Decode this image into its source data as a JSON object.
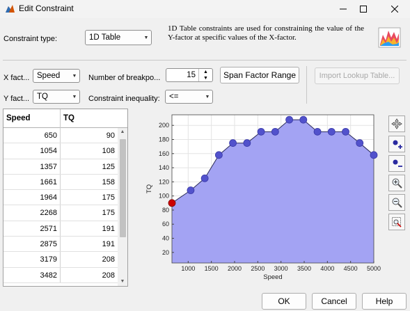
{
  "window": {
    "title": "Edit Constraint"
  },
  "constraint_type": {
    "label": "Constraint type:",
    "value": "1D Table"
  },
  "info_text": "1D Table constraints are used for constraining the value of the Y-factor at specific values of the X-factor.",
  "x_factor": {
    "label": "X fact...",
    "value": "Speed"
  },
  "y_factor": {
    "label": "Y fact...",
    "value": "TQ"
  },
  "breakpoints": {
    "label": "Number of breakpo...",
    "value": "15"
  },
  "inequality": {
    "label": "Constraint inequality:",
    "value": "<="
  },
  "buttons": {
    "span": "Span Factor Range",
    "import": "Import Lookup Table...",
    "ok": "OK",
    "cancel": "Cancel",
    "help": "Help"
  },
  "table": {
    "headers": [
      "Speed",
      "TQ"
    ],
    "rows": [
      [
        "650",
        "90"
      ],
      [
        "1054",
        "108"
      ],
      [
        "1357",
        "125"
      ],
      [
        "1661",
        "158"
      ],
      [
        "1964",
        "175"
      ],
      [
        "2268",
        "175"
      ],
      [
        "2571",
        "191"
      ],
      [
        "2875",
        "191"
      ],
      [
        "3179",
        "208"
      ],
      [
        "3482",
        "208"
      ]
    ]
  },
  "toolbar": [
    "pan-icon",
    "add-point-icon",
    "remove-point-icon",
    "zoom-in-icon",
    "zoom-out-icon",
    "zoom-reset-icon"
  ],
  "colors": {
    "fill": "#a3a3f3",
    "point": "#5252cc",
    "selected_point": "#cc0000"
  },
  "chart_data": {
    "type": "area",
    "xlabel": "Speed",
    "ylabel": "TQ",
    "xlim": [
      650,
      5000
    ],
    "ylim": [
      5,
      215
    ],
    "xticks": [
      1000,
      1500,
      2000,
      2500,
      3000,
      3500,
      4000,
      4500,
      5000
    ],
    "yticks": [
      20,
      40,
      60,
      80,
      100,
      120,
      140,
      160,
      180,
      200
    ],
    "x": [
      650,
      1054,
      1357,
      1661,
      1964,
      2268,
      2571,
      2875,
      3179,
      3482,
      3786,
      4089,
      4393,
      4696,
      5000
    ],
    "y": [
      90,
      108,
      125,
      158,
      175,
      175,
      191,
      191,
      208,
      208,
      191,
      191,
      191,
      175,
      158
    ],
    "selected_index": 0,
    "grid": true
  }
}
